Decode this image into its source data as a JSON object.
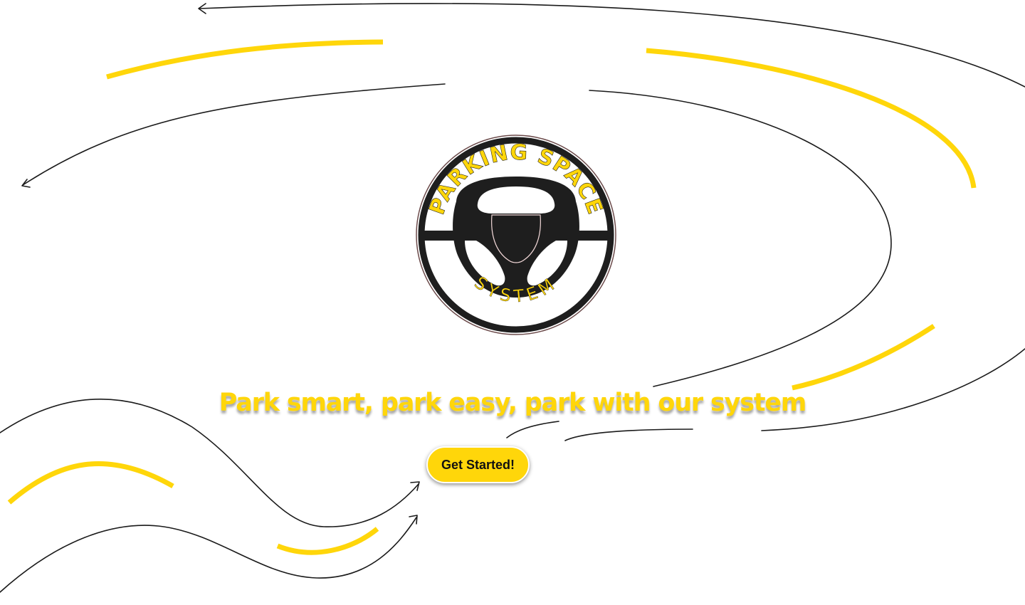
{
  "logo": {
    "top_text": "PARKING SPACE",
    "bottom_text": "SYSTEM",
    "icon": "steering-wheel-icon"
  },
  "hero": {
    "tagline": "Park smart, park easy, park with our system"
  },
  "cta": {
    "label": "Get Started!"
  },
  "colors": {
    "accent": "#ffd60a",
    "ink": "#1a1a1a",
    "background": "#ffffff"
  }
}
